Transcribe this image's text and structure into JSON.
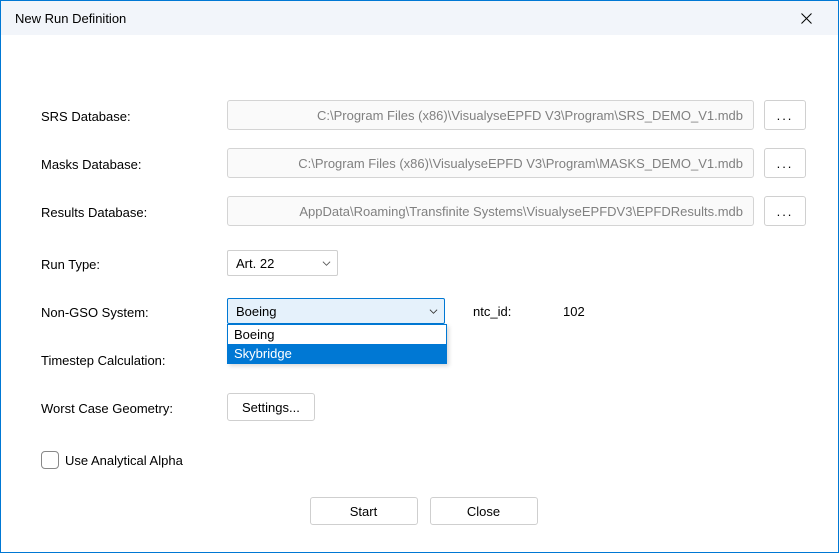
{
  "title": "New Run Definition",
  "labels": {
    "srs": "SRS Database:",
    "masks": "Masks Database:",
    "results": "Results Database:",
    "run_type": "Run Type:",
    "non_gso": "Non-GSO System:",
    "ntc_id": "ntc_id:",
    "timestep": "Timestep Calculation:",
    "worst_case": "Worst Case Geometry:",
    "use_alpha": "Use Analytical Alpha"
  },
  "values": {
    "srs_path": "C:\\Program Files (x86)\\VisualyseEPFD V3\\Program\\SRS_DEMO_V1.mdb",
    "masks_path": "C:\\Program Files (x86)\\VisualyseEPFD V3\\Program\\MASKS_DEMO_V1.mdb",
    "results_path": "AppData\\Roaming\\Transfinite Systems\\VisualyseEPFDV3\\EPFDResults.mdb",
    "run_type": "Art. 22",
    "non_gso_selected": "Boeing",
    "ntc_id": "102",
    "non_gso_options": [
      "Boeing",
      "Skybridge"
    ]
  },
  "buttons": {
    "browse": "...",
    "settings": "Settings...",
    "start": "Start",
    "close": "Close"
  }
}
